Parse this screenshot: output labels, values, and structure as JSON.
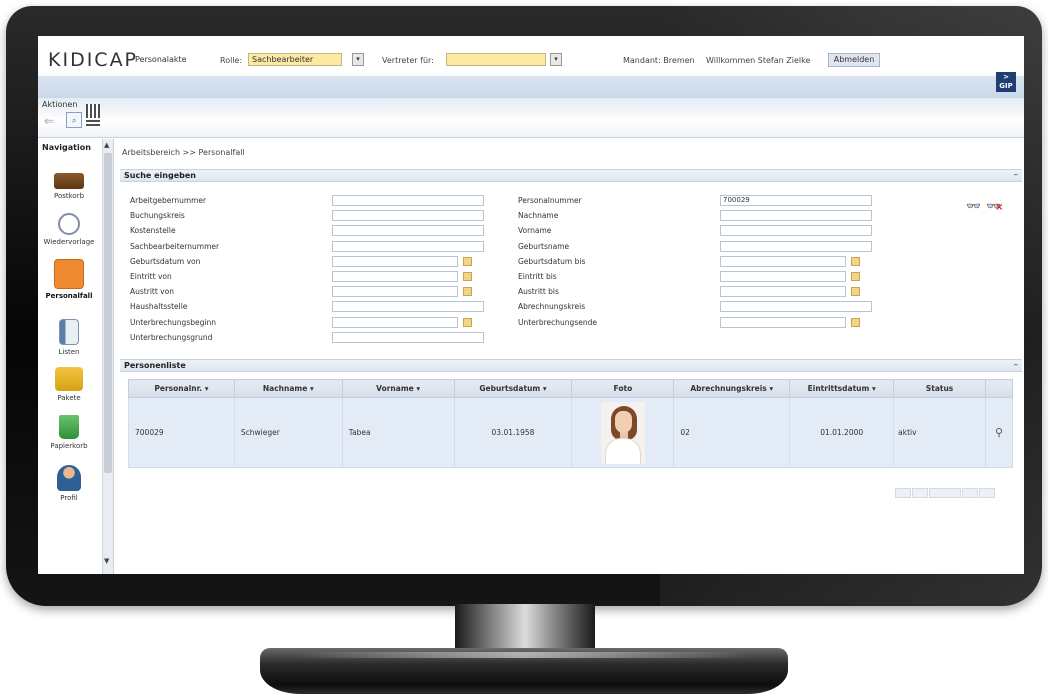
{
  "header": {
    "logo": "KIDICAP",
    "app_title": "Personalakte",
    "role_label": "Rolle:",
    "role_value": "Sachbearbeiter",
    "deputy_label": "Vertreter für:",
    "deputy_value": "",
    "client_text": "Mandant: Bremen",
    "welcome_text": "Willkommen Stefan Zielke",
    "logout_label": "Abmelden",
    "brand_logo": "GIP"
  },
  "actions": {
    "label": "Aktionen",
    "back_icon": "arrow-left-icon",
    "search_icon": "search-window-icon",
    "qr_icon": "qr-code-icon"
  },
  "sidebar": {
    "title": "Navigation",
    "items": [
      {
        "label": "Postkorb",
        "icon": "inbox-icon",
        "active": false
      },
      {
        "label": "Wiedervorlage",
        "icon": "calendar-clock-icon",
        "active": false
      },
      {
        "label": "Personalfall",
        "icon": "person-file-icon",
        "active": true
      },
      {
        "label": "Listen",
        "icon": "list-document-icon",
        "active": false
      },
      {
        "label": "Pakete",
        "icon": "folder-package-icon",
        "active": false
      },
      {
        "label": "Papierkorb",
        "icon": "trash-icon",
        "active": false
      },
      {
        "label": "Profil",
        "icon": "profile-icon",
        "active": false
      }
    ]
  },
  "main": {
    "breadcrumb": "Arbeitsbereich >> Personalfall",
    "search_section": {
      "title": "Suche eingeben",
      "collapse_label": "–",
      "left_fields": [
        {
          "label": "Arbeitgebernummer",
          "value": "",
          "date": false
        },
        {
          "label": "Buchungskreis",
          "value": "",
          "date": false
        },
        {
          "label": "Kostenstelle",
          "value": "",
          "date": false
        },
        {
          "label": "Sachbearbeiternummer",
          "value": "",
          "date": false
        },
        {
          "label": "Geburtsdatum von",
          "value": "",
          "date": true
        },
        {
          "label": "Eintritt von",
          "value": "",
          "date": true
        },
        {
          "label": "Austritt von",
          "value": "",
          "date": true
        },
        {
          "label": "Haushaltsstelle",
          "value": "",
          "date": false
        },
        {
          "label": "Unterbrechungsbeginn",
          "value": "",
          "date": true
        },
        {
          "label": "Unterbrechungsgrund",
          "value": "",
          "date": false
        }
      ],
      "right_fields": [
        {
          "label": "Personalnummer",
          "value": "700029",
          "date": false
        },
        {
          "label": "Nachname",
          "value": "",
          "date": false
        },
        {
          "label": "Vorname",
          "value": "",
          "date": false
        },
        {
          "label": "Geburtsname",
          "value": "",
          "date": false
        },
        {
          "label": "Geburtsdatum bis",
          "value": "",
          "date": true
        },
        {
          "label": "Eintritt bis",
          "value": "",
          "date": true
        },
        {
          "label": "Austritt bis",
          "value": "",
          "date": true
        },
        {
          "label": "Abrechnungskreis",
          "value": "",
          "date": false
        },
        {
          "label": "Unterbrechungsende",
          "value": "",
          "date": true
        }
      ],
      "search_icon": "binoculars-icon",
      "reset_icon": "binoculars-clear-icon"
    },
    "person_list": {
      "title": "Personenliste",
      "collapse_label": "–",
      "columns": [
        "Personalnr.",
        "Nachname",
        "Vorname",
        "Geburtsdatum",
        "Foto",
        "Abrechnungskreis",
        "Eintrittsdatum",
        "Status",
        ""
      ],
      "rows": [
        {
          "personalnr": "700029",
          "nachname": "Schwieger",
          "vorname": "Tabea",
          "geburtsdatum": "03.01.1958",
          "foto": "portrait-photo",
          "abrechnungskreis": "02",
          "eintrittsdatum": "01.01.2000",
          "status": "aktiv",
          "action_icon": "magnifier-icon"
        }
      ],
      "pager_icon": "pager-controls"
    }
  }
}
